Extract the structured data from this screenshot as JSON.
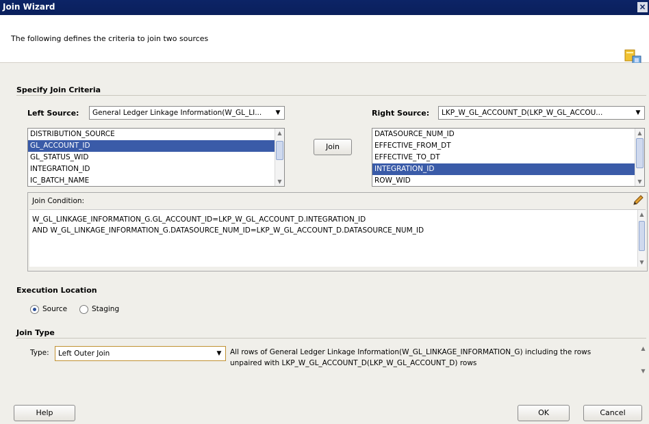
{
  "window": {
    "title": "Join Wizard",
    "close_label": "×"
  },
  "header": {
    "description": "The following defines the criteria to join two sources"
  },
  "criteria": {
    "section_title": "Specify Join Criteria",
    "left": {
      "label": "Left Source:",
      "selected": "General Ledger Linkage Information(W_GL_LI...",
      "items": [
        "DISTRIBUTION_SOURCE",
        "GL_ACCOUNT_ID",
        "GL_STATUS_WID",
        "INTEGRATION_ID",
        "IC_BATCH_NAME"
      ],
      "selected_index": 1
    },
    "right": {
      "label": "Right Source:",
      "selected": "LKP_W_GL_ACCOUNT_D(LKP_W_GL_ACCOU...",
      "items": [
        "DATASOURCE_NUM_ID",
        "EFFECTIVE_FROM_DT",
        "EFFECTIVE_TO_DT",
        "INTEGRATION_ID",
        "ROW_WID"
      ],
      "selected_index": 3
    },
    "join_button": "Join"
  },
  "condition": {
    "label": "Join Condition:",
    "lines": [
      "W_GL_LINKAGE_INFORMATION_G.GL_ACCOUNT_ID=LKP_W_GL_ACCOUNT_D.INTEGRATION_ID",
      "AND W_GL_LINKAGE_INFORMATION_G.DATASOURCE_NUM_ID=LKP_W_GL_ACCOUNT_D.DATASOURCE_NUM_ID"
    ]
  },
  "execution": {
    "section_title": "Execution Location",
    "options": [
      "Source",
      "Staging"
    ],
    "selected": "Source"
  },
  "join_type": {
    "section_title": "Join Type",
    "type_label": "Type:",
    "selected": "Left Outer Join",
    "description": "All rows of General Ledger Linkage Information(W_GL_LINKAGE_INFORMATION_G) including the rows unpaired with LKP_W_GL_ACCOUNT_D(LKP_W_GL_ACCOUNT_D) rows"
  },
  "footer": {
    "help": "Help",
    "ok": "OK",
    "cancel": "Cancel"
  }
}
